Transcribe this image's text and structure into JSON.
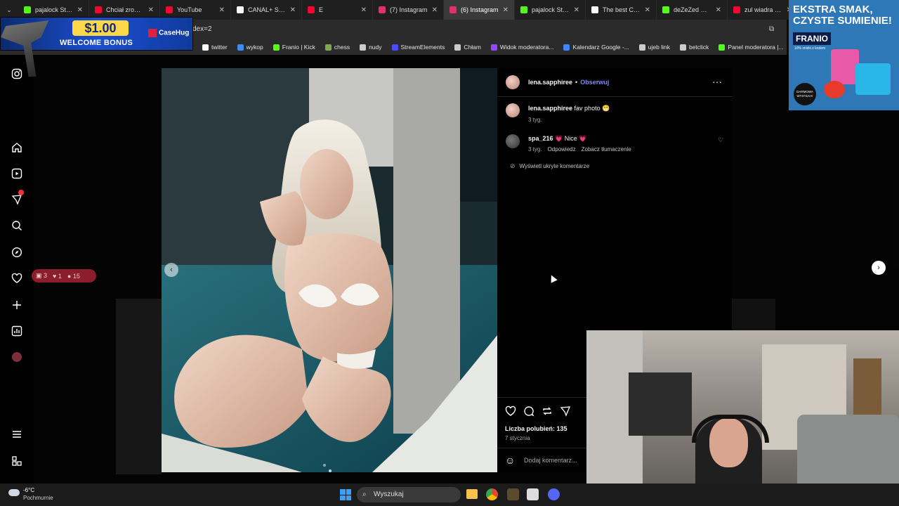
{
  "browser": {
    "tabs": [
      {
        "label": "pajalock Stream",
        "icon": "kick-icon",
        "color": "#53fc18"
      },
      {
        "label": "Chciał zrobić d",
        "icon": "youtube-icon",
        "color": "#ff0033"
      },
      {
        "label": "YouTube",
        "icon": "youtube-icon",
        "color": "#ff0033"
      },
      {
        "label": "CANAL+ SPOR",
        "icon": "x-icon",
        "color": "#ffffff"
      },
      {
        "label": "E",
        "icon": "youtube-icon",
        "color": "#ff0033"
      },
      {
        "label": "(7) Instagram",
        "icon": "instagram-icon",
        "color": "#e1306c"
      },
      {
        "label": "(6) Instagram",
        "icon": "instagram-icon",
        "color": "#e1306c",
        "active": true
      },
      {
        "label": "pajalock Stream",
        "icon": "kick-icon",
        "color": "#53fc18"
      },
      {
        "label": "The best Chat",
        "icon": "openai-icon",
        "color": "#ffffff"
      },
      {
        "label": "deZeZed w ser",
        "icon": "kick-icon",
        "color": "#53fc18"
      },
      {
        "label": "zul wiadra - Yo",
        "icon": "youtube-icon",
        "color": "#ff0033"
      }
    ],
    "url_fragment": "dex=2",
    "bookmarks": [
      {
        "label": "twitter",
        "icon": "x-icon",
        "color": "#ffffff"
      },
      {
        "label": "wykop",
        "icon": "wykop-icon",
        "color": "#3b8eea"
      },
      {
        "label": "Franio | Kick",
        "icon": "kick-icon",
        "color": "#53fc18"
      },
      {
        "label": "chess",
        "icon": "pawn-icon",
        "color": "#7fa650"
      },
      {
        "label": "nudy",
        "icon": "folder-icon",
        "color": "#cccccc"
      },
      {
        "label": "StreamElements",
        "icon": "streamelements-icon",
        "color": "#4a4aff"
      },
      {
        "label": "Chłam",
        "icon": "globe-icon",
        "color": "#cccccc"
      },
      {
        "label": "Widok moderatora...",
        "icon": "twitch-icon",
        "color": "#9146ff"
      },
      {
        "label": "Kalendarz Google -...",
        "icon": "calendar-icon",
        "color": "#4285f4"
      },
      {
        "label": "ujeb link",
        "icon": "globe-icon",
        "color": "#cccccc"
      },
      {
        "label": "betclick",
        "icon": "globe-icon",
        "color": "#cccccc"
      },
      {
        "label": "Panel moderatora |...",
        "icon": "kick-icon",
        "color": "#53fc18"
      }
    ]
  },
  "ad_left": {
    "amount": "$1.00",
    "text": "WELCOME BONUS",
    "brand": "CaseHug"
  },
  "ad_right": {
    "headline": "EKSTRA SMAK, CZYSTE SUMIENIE!",
    "brand": "FRANIO",
    "sub": "10% zniżki z kodem",
    "badge": "DARMOWA WYSYŁKA!"
  },
  "overlay_stats": {
    "comments": "3",
    "likes": "1",
    "followers": "15"
  },
  "post": {
    "author": "lena.sapphiree",
    "follow_label": "Obserwuj",
    "caption_user": "lena.sapphiree",
    "caption_text": "fav photo 😁",
    "caption_time": "3 tyg.",
    "comments": [
      {
        "user": "spa_216",
        "text": "💗 Nice 💗",
        "time": "3 tyg.",
        "reply": "Odpowiedz",
        "translate": "Zobacz tłumaczenie"
      }
    ],
    "hidden_comments": "Wyświetl ukryte komentarze",
    "likes_label": "Liczba polubień: 135",
    "date": "7 stycznia",
    "add_comment_placeholder": "Dodaj komentarz..."
  },
  "taskbar": {
    "weather_temp": "-6°C",
    "weather_desc": "Pochmurnie",
    "search": "Wyszukaj"
  }
}
